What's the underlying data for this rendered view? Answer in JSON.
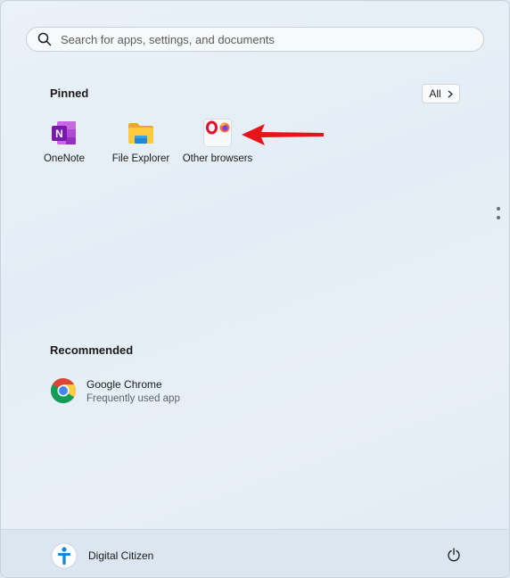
{
  "search": {
    "placeholder": "Search for apps, settings, and documents",
    "icon": "search-icon"
  },
  "pinned": {
    "title": "Pinned",
    "all_button": "All",
    "apps": [
      {
        "label": "OneNote",
        "icon": "onenote-icon"
      },
      {
        "label": "File Explorer",
        "icon": "folder-icon"
      },
      {
        "label": "Other browsers",
        "icon": "browser-folder-icon"
      }
    ]
  },
  "recommended": {
    "title": "Recommended",
    "items": [
      {
        "name": "Google Chrome",
        "subtitle": "Frequently used app",
        "icon": "chrome-icon"
      }
    ]
  },
  "footer": {
    "user_name": "Digital Citizen",
    "power_icon": "power-icon"
  },
  "annotation": {
    "arrow_color": "#e8141b"
  }
}
